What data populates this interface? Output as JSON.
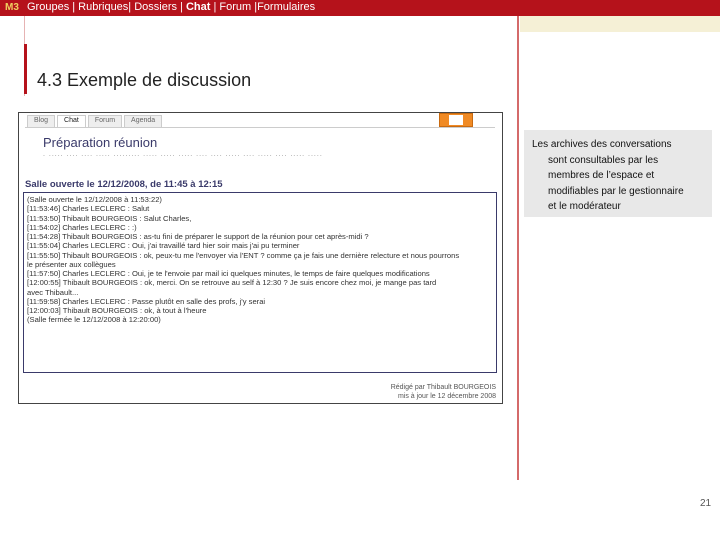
{
  "topbar": {
    "badge": "M3",
    "nav_items": [
      "Groupes",
      "Rubriques",
      "Dossiers",
      "Chat",
      "Forum",
      "Formulaires"
    ],
    "active_item": "Chat",
    "nav_text_before": "Groupes | Rubriques| Dossiers | ",
    "nav_active": "Chat",
    "nav_text_after": " | Forum |Formulaires",
    "color": "#b5121b"
  },
  "slide": {
    "title": "4.3 Exemple de discussion",
    "page_number": "21"
  },
  "screenshot": {
    "tabs": [
      "Blog",
      "Chat",
      "Forum",
      "Agenda"
    ],
    "active_tab": "Chat",
    "heading": "Préparation réunion",
    "dots": ". ..... .... .... ..... ......... ..... ..... ..... .... .... ..... .... ..... .... ..... .....",
    "salle_header": "Salle ouverte le 12/12/2008, de 11:45 à 12:15",
    "log": [
      "(Salle ouverte le 12/12/2008 à 11:53:22)",
      "[11:53:46] Charles LECLERC : Salut",
      "[11:53:50] Thibault BOURGEOIS : Salut Charles,",
      "[11:54:02] Charles LECLERC : :)",
      "[11:54:28] Thibault BOURGEOIS : as-tu fini de préparer le support de la réunion pour cet après-midi ?",
      "[11:55:04] Charles LECLERC : Oui, j'ai travaillé tard hier soir mais j'ai pu terminer",
      "[11:55:50] Thibault BOURGEOIS : ok, peux-tu me l'envoyer via l'ENT ? comme ça je fais une dernière relecture et nous pourrons",
      "le présenter aux collègues",
      "[11:57:50] Charles LECLERC : Oui, je te l'envoie par mail ici quelques minutes, le temps de faire quelques modifications",
      "[12:00:55] Thibault BOURGEOIS : ok, merci. On se retrouve au self à 12:30 ? Je suis encore chez moi, je mange pas tard",
      "avec Thibault...",
      "[11:59:58] Charles LECLERC : Passe plutôt en salle des profs, j'y serai",
      "[12:00:03] Thibault BOURGEOIS : ok, à tout à l'heure",
      "(Salle fermée le 12/12/2008 à 12:20:00)"
    ],
    "footer_line1": "Rédigé par Thibault BOURGEOIS",
    "footer_line2": "mis à jour le 12 décembre 2008"
  },
  "note": {
    "first_line": "Les archives des conversations",
    "lines": [
      "sont consultables par les",
      "membres de l’espace et",
      "modifiables par le gestionnaire",
      "et le modérateur"
    ]
  },
  "colors": {
    "brand_red": "#b5121b",
    "badge_yellow": "#f0d060",
    "cream": "#f5f0d6",
    "note_bg": "#e8e8e8",
    "chat_blue": "#3a3a6a",
    "envelope_orange": "#f08a24"
  },
  "icons": [
    "envelope-icon"
  ]
}
